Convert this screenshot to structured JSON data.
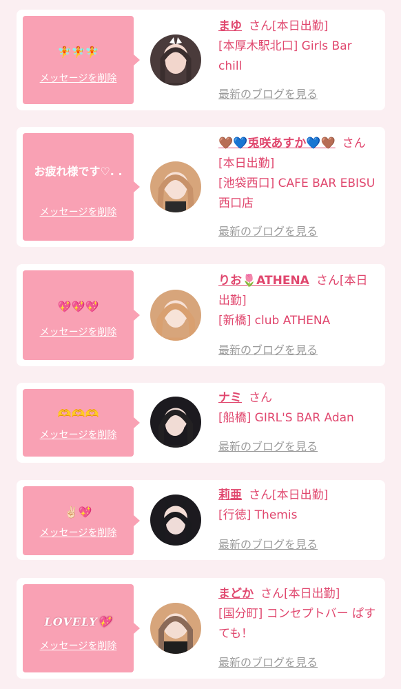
{
  "colors": {
    "page_background": "#fbeff2",
    "card_background": "#ffffff",
    "bubble_pink": "#f9a1b4",
    "accent_text": "#e0476e",
    "link_gray": "#9a9a9a"
  },
  "items": [
    {
      "message": "🧚🧚🧚",
      "delete_label": "メッセージを削除",
      "name": "まゆ",
      "honorific": "さん",
      "status": "[本日出勤]",
      "shop": "[本厚木駅北口] Girls Bar chill",
      "blog_label": "最新のブログを見る",
      "avatar_icon": "avatar-photo"
    },
    {
      "message": "お疲れ様です♡. .",
      "delete_label": "メッセージを削除",
      "name": "🤎💙兎咲あすか💙🤎",
      "honorific": "さん",
      "status": "[本日出勤]",
      "shop": "[池袋西口] CAFE BAR EBISU 西口店",
      "blog_label": "最新のブログを見る",
      "avatar_icon": "avatar-photo"
    },
    {
      "message": "💖💖💖",
      "delete_label": "メッセージを削除",
      "name": "りお🌷ATHENA",
      "honorific": "さん",
      "status": "[本日出勤]",
      "shop": "[新橋] club ATHENA",
      "blog_label": "最新のブログを見る",
      "avatar_icon": "avatar-photo"
    },
    {
      "message": "🫶🫶🫶",
      "delete_label": "メッセージを削除",
      "name": "ナミ",
      "honorific": "さん",
      "status": "",
      "shop": "[船橋] GIRL'S BAR Adan",
      "blog_label": "最新のブログを見る",
      "avatar_icon": "avatar-photo"
    },
    {
      "message": "✌🏻💖",
      "delete_label": "メッセージを削除",
      "name": "莉亜",
      "honorific": "さん",
      "status": "[本日出勤]",
      "shop": "[行徳] Themis",
      "blog_label": "最新のブログを見る",
      "avatar_icon": "avatar-photo"
    },
    {
      "message": "LOVELY💖",
      "delete_label": "メッセージを削除",
      "name": "まどか",
      "honorific": "さん",
      "status": "[本日出勤]",
      "shop": "[国分町] コンセプトバー ぱすても！",
      "blog_label": "最新のブログを見る",
      "avatar_icon": "avatar-photo"
    }
  ]
}
